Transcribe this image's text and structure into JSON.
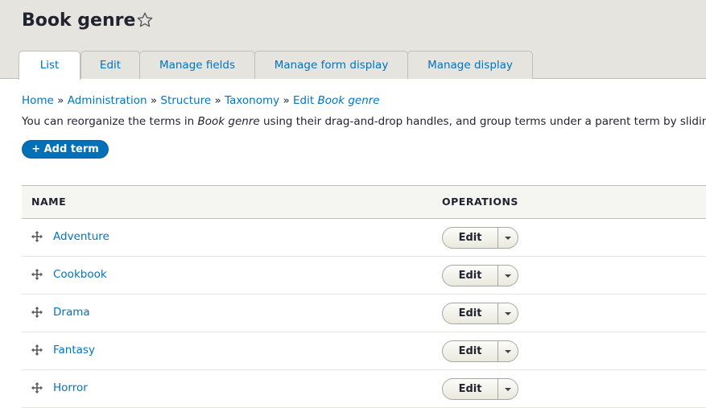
{
  "page": {
    "title": "Book genre",
    "star_icon": "star-outline-icon"
  },
  "tabs": [
    {
      "label": "List",
      "active": true
    },
    {
      "label": "Edit",
      "active": false
    },
    {
      "label": "Manage fields",
      "active": false
    },
    {
      "label": "Manage form display",
      "active": false
    },
    {
      "label": "Manage display",
      "active": false
    }
  ],
  "breadcrumb": {
    "home": "Home",
    "administration": "Administration",
    "structure": "Structure",
    "taxonomy": "Taxonomy",
    "edit_prefix": "Edit ",
    "edit_em": "Book genre",
    "separator": "»"
  },
  "help": {
    "before": "You can reorganize the terms in ",
    "em": "Book genre",
    "after": " using their drag-and-drop handles, and group terms under a parent term by sliding them"
  },
  "actions": {
    "add_term": "+ Add term"
  },
  "table": {
    "headers": {
      "name": "NAME",
      "operations": "OPERATIONS"
    },
    "rows": [
      {
        "name": "Adventure",
        "operation": "Edit"
      },
      {
        "name": "Cookbook",
        "operation": "Edit"
      },
      {
        "name": "Drama",
        "operation": "Edit"
      },
      {
        "name": "Fantasy",
        "operation": "Edit"
      },
      {
        "name": "Horror",
        "operation": "Edit"
      }
    ]
  },
  "colors": {
    "link": "#0074bd",
    "header_bg": "#e6e4df",
    "primary_button": "#0071b8"
  }
}
